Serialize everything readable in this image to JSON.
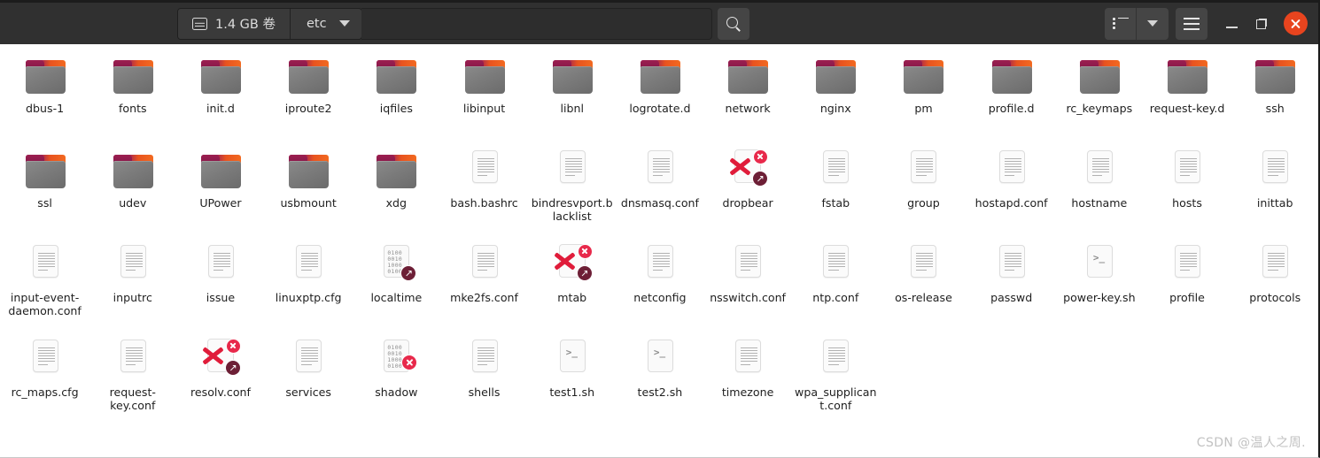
{
  "window": {
    "title": "etc",
    "colors": {
      "headerbar_bg": "#303030",
      "content_bg": "#ffffff",
      "close_button": "#e8441e",
      "folder_accent_purple": "#9c1f50",
      "folder_accent_orange": "#f26a20",
      "broken_link_red": "#e01c3a",
      "symlink_badge": "#6d1f36"
    }
  },
  "headerbar": {
    "breadcrumb": {
      "volume_label": "1.4 GB 卷",
      "volume_icon": "drive-harddisk-icon",
      "current_folder": "etc",
      "dropdown_icon": "chevron-down-icon"
    },
    "search_icon": "search-icon",
    "view_list_icon": "list-view-icon",
    "view_dropdown_icon": "chevron-down-icon",
    "menu_icon": "hamburger-menu-icon",
    "minimize_icon": "minimize-icon",
    "maximize_icon": "maximize-icon",
    "close_icon": "close-icon"
  },
  "files": [
    {
      "name": "dbus-1",
      "type": "folder"
    },
    {
      "name": "fonts",
      "type": "folder"
    },
    {
      "name": "init.d",
      "type": "folder"
    },
    {
      "name": "iproute2",
      "type": "folder"
    },
    {
      "name": "iqfiles",
      "type": "folder"
    },
    {
      "name": "libinput",
      "type": "folder"
    },
    {
      "name": "libnl",
      "type": "folder"
    },
    {
      "name": "logrotate.d",
      "type": "folder"
    },
    {
      "name": "network",
      "type": "folder"
    },
    {
      "name": "nginx",
      "type": "folder"
    },
    {
      "name": "pm",
      "type": "folder"
    },
    {
      "name": "profile.d",
      "type": "folder"
    },
    {
      "name": "rc_keymaps",
      "type": "folder"
    },
    {
      "name": "request-key.d",
      "type": "folder"
    },
    {
      "name": "ssh",
      "type": "folder"
    },
    {
      "name": "ssl",
      "type": "folder"
    },
    {
      "name": "udev",
      "type": "folder"
    },
    {
      "name": "UPower",
      "type": "folder"
    },
    {
      "name": "usbmount",
      "type": "folder"
    },
    {
      "name": "xdg",
      "type": "folder"
    },
    {
      "name": "bash.bashrc",
      "type": "text"
    },
    {
      "name": "bindresvport.blacklist",
      "type": "text"
    },
    {
      "name": "dnsmasq.conf",
      "type": "text"
    },
    {
      "name": "dropbear",
      "type": "broken-symlink"
    },
    {
      "name": "fstab",
      "type": "text"
    },
    {
      "name": "group",
      "type": "text"
    },
    {
      "name": "hostapd.conf",
      "type": "text"
    },
    {
      "name": "hostname",
      "type": "text"
    },
    {
      "name": "hosts",
      "type": "text"
    },
    {
      "name": "inittab",
      "type": "text"
    },
    {
      "name": "input-event-daemon.conf",
      "type": "text"
    },
    {
      "name": "inputrc",
      "type": "text"
    },
    {
      "name": "issue",
      "type": "text"
    },
    {
      "name": "linuxptp.cfg",
      "type": "text"
    },
    {
      "name": "localtime",
      "type": "binary-symlink"
    },
    {
      "name": "mke2fs.conf",
      "type": "text"
    },
    {
      "name": "mtab",
      "type": "broken-symlink"
    },
    {
      "name": "netconfig",
      "type": "text"
    },
    {
      "name": "nsswitch.conf",
      "type": "text"
    },
    {
      "name": "ntp.conf",
      "type": "text"
    },
    {
      "name": "os-release",
      "type": "text"
    },
    {
      "name": "passwd",
      "type": "text"
    },
    {
      "name": "power-key.sh",
      "type": "script"
    },
    {
      "name": "profile",
      "type": "text"
    },
    {
      "name": "protocols",
      "type": "text"
    },
    {
      "name": "rc_maps.cfg",
      "type": "text"
    },
    {
      "name": "request-key.conf",
      "type": "text"
    },
    {
      "name": "resolv.conf",
      "type": "broken-symlink"
    },
    {
      "name": "services",
      "type": "text"
    },
    {
      "name": "shadow",
      "type": "binary-noaccess"
    },
    {
      "name": "shells",
      "type": "text"
    },
    {
      "name": "test1.sh",
      "type": "script"
    },
    {
      "name": "test2.sh",
      "type": "script"
    },
    {
      "name": "timezone",
      "type": "text"
    },
    {
      "name": "wpa_supplicant.conf",
      "type": "text"
    }
  ],
  "binary_icon_digits": "0100\n0010\n1000\n0100",
  "script_icon_glyph": ">_",
  "symlink_badge_glyph": "↗",
  "watermark": "CSDN @温人之周."
}
